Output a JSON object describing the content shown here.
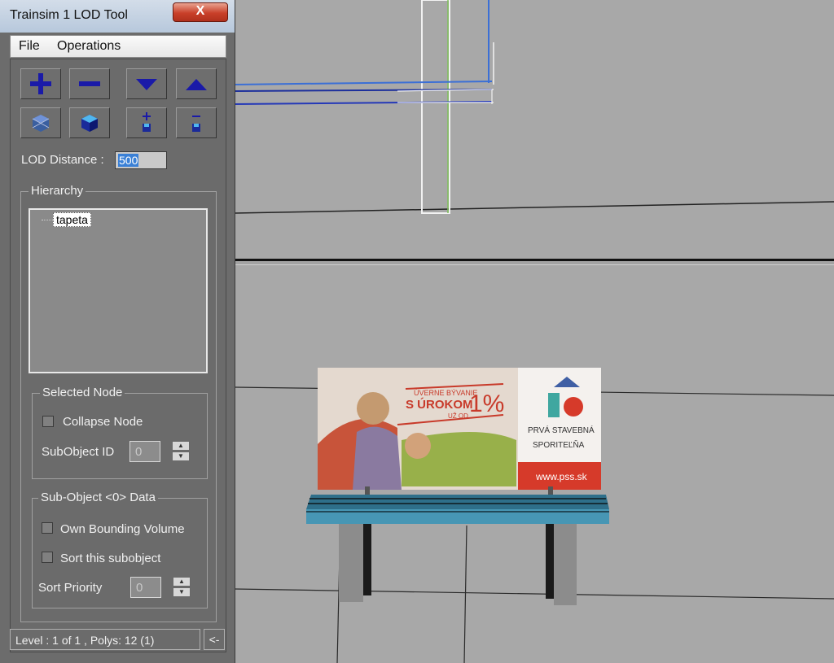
{
  "window": {
    "title": "Trainsim 1 LOD Tool",
    "close_glyph": "X"
  },
  "menu": {
    "items": [
      "File",
      "Operations"
    ]
  },
  "toolbar": {
    "buttons": [
      {
        "name": "add-lod-button",
        "icon": "plus-icon"
      },
      {
        "name": "remove-lod-button",
        "icon": "minus-icon"
      },
      {
        "name": "move-down-button",
        "icon": "triangle-down-icon"
      },
      {
        "name": "move-up-button",
        "icon": "triangle-up-icon"
      },
      {
        "name": "wire-cube-button",
        "icon": "wire-cube-icon"
      },
      {
        "name": "solid-cube-button",
        "icon": "solid-cube-icon"
      },
      {
        "name": "add-subobject-button",
        "icon": "add-subobject-icon"
      },
      {
        "name": "remove-subobject-button",
        "icon": "remove-subobject-icon"
      }
    ]
  },
  "lod": {
    "label": "LOD Distance :",
    "value": "500"
  },
  "hierarchy": {
    "title": "Hierarchy",
    "nodes": [
      "tapeta"
    ]
  },
  "selected_node": {
    "title": "Selected Node",
    "collapse_label": "Collapse Node",
    "subobject_label": "SubObject ID",
    "subobject_value": "0"
  },
  "subobject_data": {
    "title": "Sub-Object <0> Data",
    "own_bounding_label": "Own Bounding Volume",
    "sort_label": "Sort this subobject",
    "priority_label": "Sort Priority",
    "priority_value": "0"
  },
  "status": {
    "text": "Level : 1 of 1 , Polys: 12 (1)",
    "collapse_glyph": "<-"
  },
  "colors": {
    "toolbar_icon": "#1a1aa8",
    "viewport": "#a8a8a8",
    "billboard_red": "#d63a2a",
    "bench_top": "#3c8aa6"
  },
  "billboard": {
    "headline": "ÚVERNE BÝVANIE",
    "main": "S ÚROKOM",
    "percent": "1%",
    "small": "UŽ OD",
    "brand_line1": "PRVÁ STAVEBNÁ",
    "brand_line2": "SPORITEĽŇA",
    "url": "www.pss.sk"
  }
}
